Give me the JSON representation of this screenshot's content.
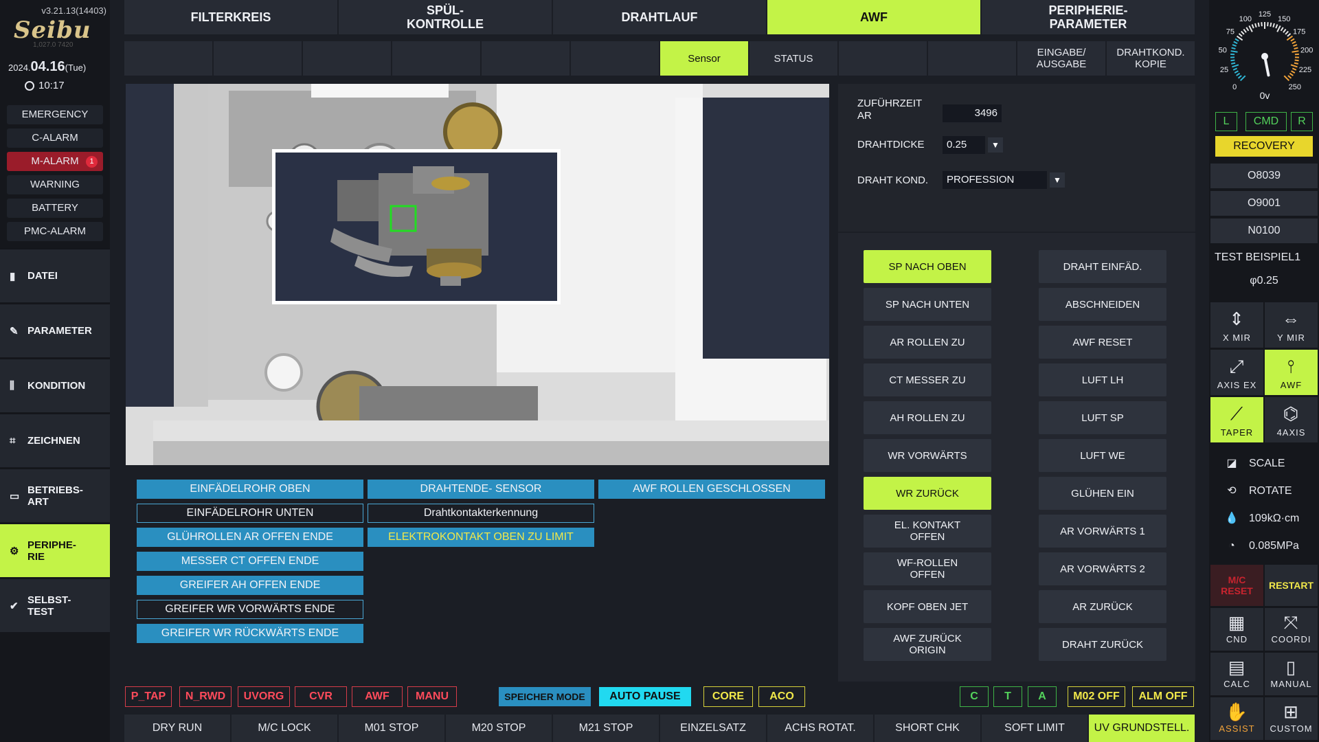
{
  "app": {
    "version": "v3.21.13(14403)",
    "logo": "Seibu",
    "logo_sub": "1,027.0    7420",
    "date_prefix": "2024.",
    "date": "04.16",
    "weekday": "(Tue)",
    "time": "10:17"
  },
  "alarms": [
    {
      "label": "EMERGENCY"
    },
    {
      "label": "C-ALARM"
    },
    {
      "label": "M-ALARM",
      "count": "1",
      "active": true
    },
    {
      "label": "WARNING"
    },
    {
      "label": "BATTERY"
    },
    {
      "label": "PMC-ALARM"
    }
  ],
  "nav": [
    {
      "label": "DATEI",
      "icon": "file-icon"
    },
    {
      "label": "PARAMETER",
      "icon": "pen-icon"
    },
    {
      "label": "KONDITION",
      "icon": "sliders-icon"
    },
    {
      "label": "ZEICHNEN",
      "icon": "draw-icon"
    },
    {
      "label": "BETRIEBS-\nART",
      "icon": "mode-icon"
    },
    {
      "label": "PERIPHE-\nRIE",
      "icon": "gear-icon",
      "active": true
    },
    {
      "label": "SELBST-\nTEST",
      "icon": "check-icon"
    }
  ],
  "tabs": [
    "FILTERKREIS",
    "SPÜL-\nKONTROLLE",
    "DRAHTLAUF",
    "AWF",
    "PERIPHERIE-\nPARAMETER"
  ],
  "active_tab": "AWF",
  "subtabs": [
    "",
    "",
    "",
    "",
    "",
    "",
    "Sensor",
    "STATUS",
    "",
    "",
    "EINGABE/\nAUSGABE",
    "DRAHTKOND.\nKOPIE"
  ],
  "active_subtab": "Sensor",
  "sensors": [
    {
      "label": "EINFÄDELROHR OBEN",
      "style": "fill"
    },
    {
      "label": "DRAHTENDE- SENSOR",
      "style": "fill"
    },
    {
      "label": "AWF ROLLEN GESCHLOSSEN",
      "style": "fill"
    },
    {
      "label": "EINFÄDELROHR UNTEN",
      "style": "outline"
    },
    {
      "label": "Drahtkontakterkennung",
      "style": "outline"
    },
    {
      "label": "GLÜHROLLEN AR OFFEN ENDE",
      "style": "fill"
    },
    {
      "label": "ELEKTROKONTAKT OBEN ZU LIMIT",
      "style": "yellow"
    },
    {
      "label": "MESSER CT OFFEN ENDE",
      "style": "fill"
    },
    {
      "label": "GREIFER AH OFFEN ENDE",
      "style": "fill"
    },
    {
      "label": "GREIFER WR VORWÄRTS ENDE",
      "style": "outline"
    },
    {
      "label": "GREIFER WR RÜCKWÄRTS ENDE",
      "style": "fill"
    }
  ],
  "settings": {
    "feed_time_label": "ZUFÜHRZEIT\nAR",
    "feed_time_value": "3496",
    "wire_dia_label": "DRAHTDICKE",
    "wire_dia_value": "0.25",
    "wire_cond_label": "DRAHT KOND.",
    "wire_cond_value": "PROFESSION"
  },
  "commands_left": [
    {
      "label": "SP NACH OBEN",
      "active": true
    },
    {
      "label": "SP NACH UNTEN"
    },
    {
      "label": "AR ROLLEN ZU"
    },
    {
      "label": "CT MESSER ZU"
    },
    {
      "label": "AH ROLLEN ZU"
    },
    {
      "label": "WR VORWÄRTS"
    },
    {
      "label": "WR ZURÜCK",
      "active": true
    },
    {
      "label": "EL. KONTAKT\nOFFEN"
    },
    {
      "label": "WF-ROLLEN\nOFFEN"
    },
    {
      "label": "KOPF OBEN JET"
    },
    {
      "label": "AWF ZURÜCK\nORIGIN"
    }
  ],
  "commands_right": [
    {
      "label": "DRAHT EINFÄD."
    },
    {
      "label": "ABSCHNEIDEN"
    },
    {
      "label": "AWF RESET"
    },
    {
      "label": "LUFT LH"
    },
    {
      "label": "LUFT SP"
    },
    {
      "label": "LUFT WE"
    },
    {
      "label": "GLÜHEN EIN"
    },
    {
      "label": "AR VORWÄRTS 1"
    },
    {
      "label": "AR VORWÄRTS 2"
    },
    {
      "label": "AR ZURÜCK"
    },
    {
      "label": "DRAHT ZURÜCK"
    }
  ],
  "footer_flags": [
    "P_TAP",
    "N_RWD",
    "UVORG",
    "CVR",
    "AWF",
    "MANU"
  ],
  "speicher_mode": "SPEICHER MODE",
  "auto_pause": "AUTO PAUSE",
  "mode_flags": [
    "CORE",
    "ACO"
  ],
  "axis_flags": [
    "C",
    "T",
    "A"
  ],
  "m_flags": [
    "M02 OFF",
    "ALM OFF"
  ],
  "bottom_tabs": [
    "DRY RUN",
    "M/C LOCK",
    "M01 STOP",
    "M20 STOP",
    "M21 STOP",
    "EINZELSATZ",
    "ACHS ROTAT.",
    "SHORT CHK",
    "SOFT LIMIT",
    "UV GRUNDSTELL."
  ],
  "active_bottom": "UV GRUNDSTELL.",
  "gauge": {
    "ticks": [
      "0",
      "25",
      "50",
      "75",
      "100",
      "125",
      "150",
      "175",
      "200",
      "225",
      "250"
    ],
    "value": 0,
    "label": "0v",
    "max": 250
  },
  "lcr": [
    "L",
    "CMD",
    "R"
  ],
  "recovery": "RECOVERY",
  "programs": [
    "O8039",
    "O9001",
    "N0100"
  ],
  "test_name": "TEST BEISPIEL1",
  "wire_phi": "φ0.25",
  "tools": [
    {
      "label": "X MIR",
      "icon": "x-mirror-icon"
    },
    {
      "label": "Y MIR",
      "icon": "y-mirror-icon"
    },
    {
      "label": "AXIS EX",
      "icon": "axis-exchange-icon"
    },
    {
      "label": "AWF",
      "icon": "awf-icon",
      "active": true
    },
    {
      "label": "TAPER",
      "icon": "taper-icon",
      "active": true
    },
    {
      "label": "4AXIS",
      "icon": "four-axis-icon"
    }
  ],
  "readouts": [
    {
      "label": "SCALE",
      "icon": "scale-icon"
    },
    {
      "label": "ROTATE",
      "icon": "rotate-icon"
    },
    {
      "label": "109kΩ·cm",
      "icon": "water-drop-icon"
    },
    {
      "label": "0.085MPa",
      "icon": "pressure-gauge-icon"
    }
  ],
  "mc_reset": "M/C\nRESET",
  "restart": "RESTART",
  "bottom_tools": [
    {
      "label": "CND",
      "icon": "cnd-icon"
    },
    {
      "label": "COORDI",
      "icon": "coordinate-icon"
    },
    {
      "label": "CALC",
      "icon": "calculator-icon"
    },
    {
      "label": "MANUAL",
      "icon": "manual-icon"
    },
    {
      "label": "ASSIST",
      "icon": "assist-hand-icon"
    },
    {
      "label": "CUSTOM",
      "icon": "custom-icon"
    }
  ],
  "colors": {
    "accent": "#c3f347",
    "sensor_on": "#2a8fc0",
    "alarm_red": "#9a1c2a",
    "flag_red": "#ff4b5b",
    "flag_yellow": "#f1e84a",
    "flag_green": "#54d35c",
    "cyan": "#21d9f0"
  }
}
